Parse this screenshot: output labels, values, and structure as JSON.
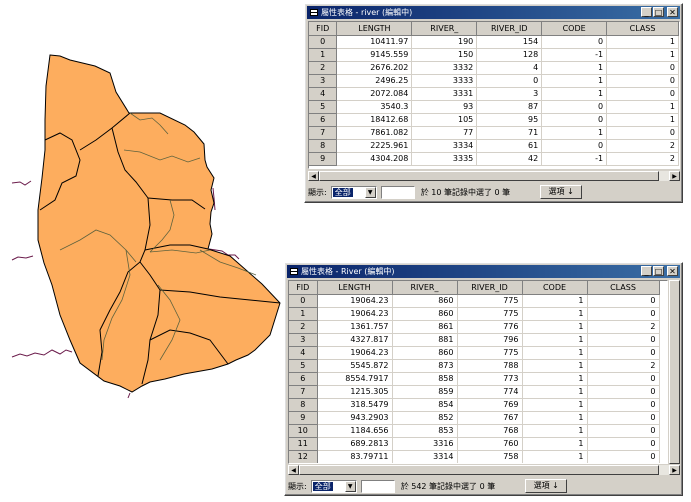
{
  "window1": {
    "title": "屬性表格 - river (編輯中)",
    "columns": [
      "FID",
      "LENGTH",
      "RIVER_",
      "RIVER_ID",
      "CODE",
      "CLASS"
    ],
    "rows": [
      [
        "0",
        "10411.97",
        "190",
        "154",
        "0",
        "1"
      ],
      [
        "1",
        "9145.559",
        "150",
        "128",
        "-1",
        "1"
      ],
      [
        "2",
        "2676.202",
        "3332",
        "4",
        "1",
        "0"
      ],
      [
        "3",
        "2496.25",
        "3333",
        "0",
        "1",
        "0"
      ],
      [
        "4",
        "2072.084",
        "3331",
        "3",
        "1",
        "0"
      ],
      [
        "5",
        "3540.3",
        "93",
        "87",
        "0",
        "1"
      ],
      [
        "6",
        "18412.68",
        "105",
        "95",
        "0",
        "1"
      ],
      [
        "7",
        "7861.082",
        "77",
        "71",
        "1",
        "0"
      ],
      [
        "8",
        "2225.961",
        "3334",
        "61",
        "0",
        "2"
      ],
      [
        "9",
        "4304.208",
        "3335",
        "42",
        "-1",
        "2"
      ]
    ],
    "show_label": "顯示:",
    "show_value": "全部",
    "status": "於 10 筆記錄中選了 0 筆",
    "options_label": "選項 ↓"
  },
  "window2": {
    "title": "屬性表格 - River (編輯中)",
    "columns": [
      "FID",
      "LENGTH",
      "RIVER_",
      "RIVER_ID",
      "CODE",
      "CLASS"
    ],
    "rows": [
      [
        "0",
        "19064.23",
        "860",
        "775",
        "1",
        "0"
      ],
      [
        "1",
        "19064.23",
        "860",
        "775",
        "1",
        "0"
      ],
      [
        "2",
        "1361.757",
        "861",
        "776",
        "1",
        "2"
      ],
      [
        "3",
        "4327.817",
        "881",
        "796",
        "1",
        "0"
      ],
      [
        "4",
        "19064.23",
        "860",
        "775",
        "1",
        "0"
      ],
      [
        "5",
        "5545.872",
        "873",
        "788",
        "1",
        "2"
      ],
      [
        "6",
        "8554.7917",
        "858",
        "773",
        "1",
        "0"
      ],
      [
        "7",
        "1215.305",
        "859",
        "774",
        "1",
        "0"
      ],
      [
        "8",
        "318.5479",
        "854",
        "769",
        "1",
        "0"
      ],
      [
        "9",
        "943.2903",
        "852",
        "767",
        "1",
        "0"
      ],
      [
        "10",
        "1184.656",
        "853",
        "768",
        "1",
        "0"
      ],
      [
        "11",
        "689.2813",
        "3316",
        "760",
        "1",
        "0"
      ],
      [
        "12",
        "83.79711",
        "3314",
        "758",
        "1",
        "0"
      ]
    ],
    "show_label": "顯示:",
    "show_value": "全部",
    "status": "於 542 筆記錄中選了 0 筆",
    "options_label": "選項 ↓"
  },
  "map": {
    "fill_color": "#fdad5e",
    "boundary_color": "#000000",
    "river_color": "#6a1a4a"
  }
}
